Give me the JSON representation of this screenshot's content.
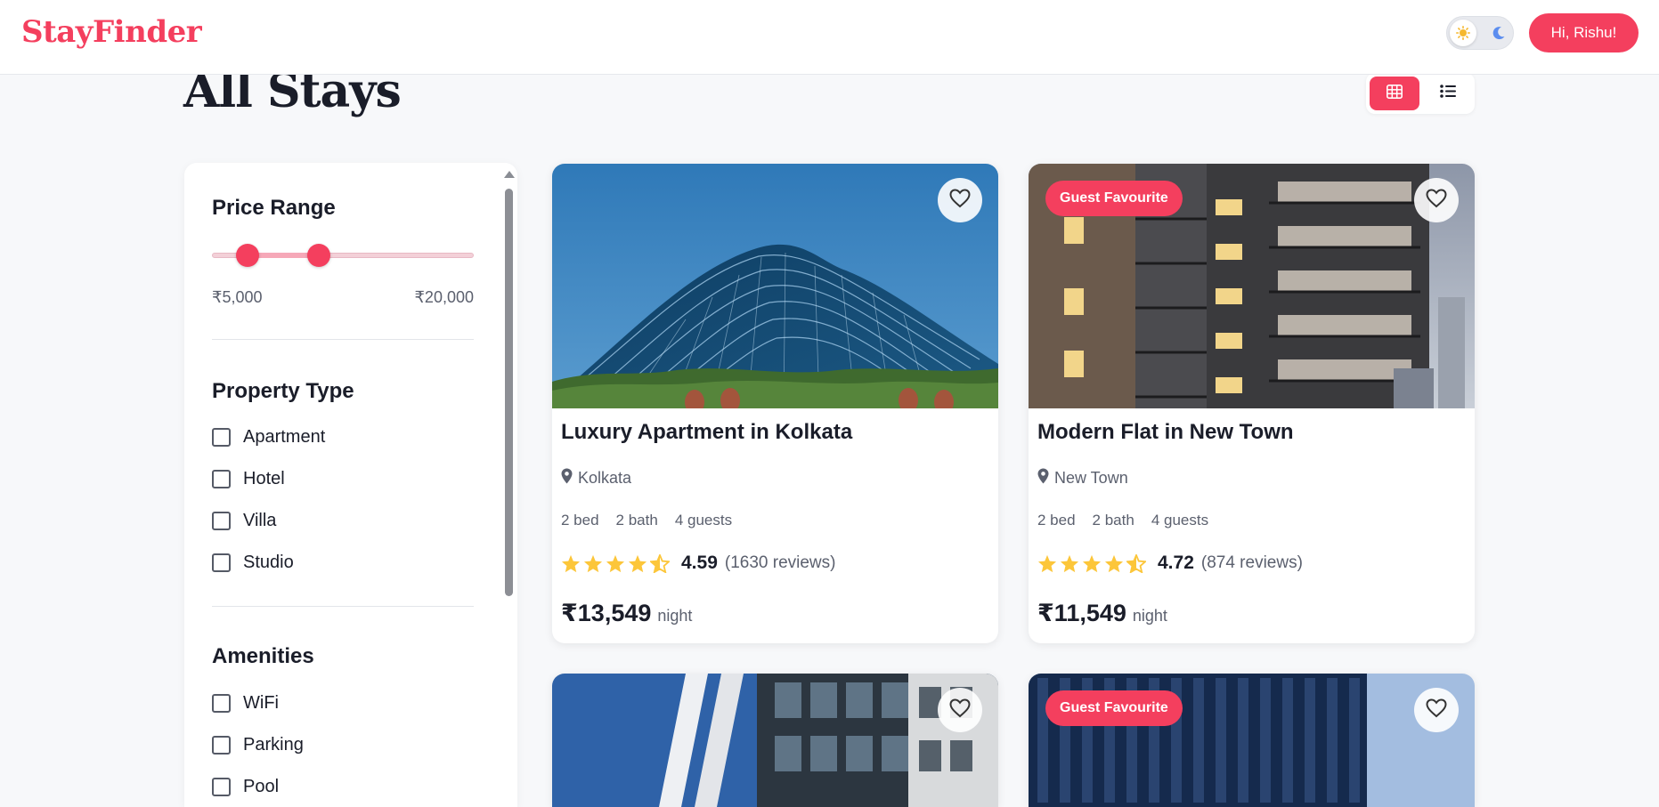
{
  "header": {
    "brand": "StayFinder",
    "user_button": "Hi, Rishu!"
  },
  "page": {
    "title": "All Stays"
  },
  "filters": {
    "price_range": {
      "heading": "Price Range",
      "min_label": "₹5,000",
      "max_label": "₹20,000"
    },
    "property_type": {
      "heading": "Property Type",
      "options": [
        "Apartment",
        "Hotel",
        "Villa",
        "Studio"
      ]
    },
    "amenities": {
      "heading": "Amenities",
      "options": [
        "WiFi",
        "Parking",
        "Pool"
      ]
    }
  },
  "listings": [
    {
      "badge": "",
      "title": "Luxury Apartment in Kolkata",
      "location": "Kolkata",
      "beds": "2 bed",
      "baths": "2 bath",
      "guests": "4 guests",
      "rating": "4.59",
      "reviews": "(1630 reviews)",
      "price": "₹13,549",
      "unit": "night"
    },
    {
      "badge": "Guest Favourite",
      "title": "Modern Flat in New Town",
      "location": "New Town",
      "beds": "2 bed",
      "baths": "2 bath",
      "guests": "4 guests",
      "rating": "4.72",
      "reviews": "(874 reviews)",
      "price": "₹11,549",
      "unit": "night"
    },
    {
      "badge": ""
    },
    {
      "badge": "Guest Favourite"
    }
  ],
  "colors": {
    "accent": "#f43f5e",
    "star": "#fcc63a",
    "text": "#1a1d29",
    "muted": "#5b606e"
  }
}
